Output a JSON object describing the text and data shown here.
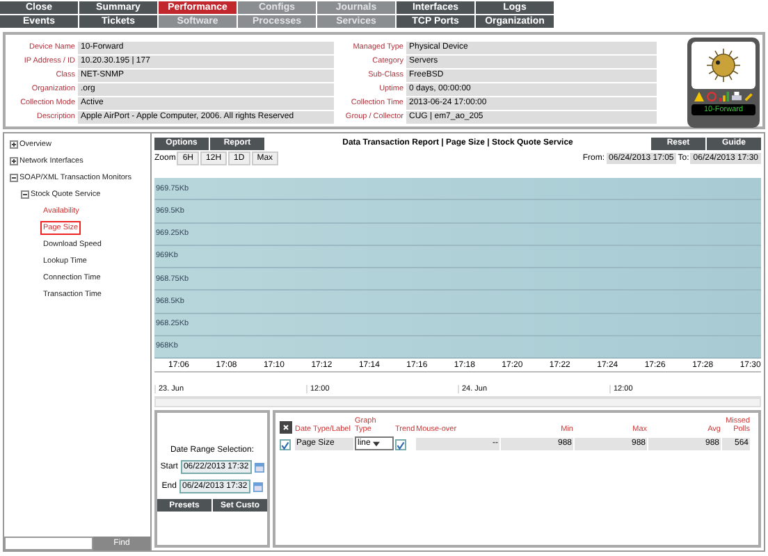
{
  "nav_rows": [
    [
      {
        "label": "Close",
        "selected": false,
        "disabled": false
      },
      {
        "label": "Summary",
        "selected": false,
        "disabled": false
      },
      {
        "label": "Performance",
        "selected": true,
        "disabled": false
      },
      {
        "label": "Configs",
        "selected": false,
        "disabled": true
      },
      {
        "label": "Journals",
        "selected": false,
        "disabled": true
      },
      {
        "label": "Interfaces",
        "selected": false,
        "disabled": false
      },
      {
        "label": "Logs",
        "selected": false,
        "disabled": false
      }
    ],
    [
      {
        "label": "Events",
        "selected": false,
        "disabled": false
      },
      {
        "label": "Tickets",
        "selected": false,
        "disabled": false
      },
      {
        "label": "Software",
        "selected": false,
        "disabled": true
      },
      {
        "label": "Processes",
        "selected": false,
        "disabled": true
      },
      {
        "label": "Services",
        "selected": false,
        "disabled": true
      },
      {
        "label": "TCP Ports",
        "selected": false,
        "disabled": false
      },
      {
        "label": "Organization",
        "selected": false,
        "disabled": false
      }
    ]
  ],
  "device_info": {
    "left": [
      {
        "label": "Device Name",
        "value": "10-Forward"
      },
      {
        "label": "IP Address / ID",
        "value": "10.20.30.195 | 177"
      },
      {
        "label": "Class",
        "value": "NET-SNMP"
      },
      {
        "label": "Organization",
        "value": ".org"
      },
      {
        "label": "Collection Mode",
        "value": "Active"
      },
      {
        "label": "Description",
        "value": "Apple AirPort - Apple Computer, 2006. All rights Reserved"
      }
    ],
    "right": [
      {
        "label": "Managed Type",
        "value": "Physical Device"
      },
      {
        "label": "Category",
        "value": "Servers"
      },
      {
        "label": "Sub-Class",
        "value": "FreeBSD"
      },
      {
        "label": "Uptime",
        "value": "0 days, 00:00:00"
      },
      {
        "label": "Collection Time",
        "value": "2013-06-24 17:00:00"
      },
      {
        "label": "Group / Collector",
        "value": "CUG | em7_ao_205"
      }
    ],
    "card_name": "10-Forward"
  },
  "tree": [
    {
      "label": "Overview",
      "expanded": false,
      "selected": false
    },
    {
      "label": "Network Interfaces",
      "expanded": false,
      "selected": false
    },
    {
      "label": "SOAP/XML Transaction Monitors",
      "expanded": true,
      "selected": false,
      "children": [
        {
          "label": "Stock Quote Service",
          "expanded": true,
          "selected": false,
          "children": [
            {
              "label": "Availability",
              "selected": false,
              "alert": true
            },
            {
              "label": "Page Size",
              "selected": true,
              "alert": true
            },
            {
              "label": "Download Speed",
              "selected": false,
              "alert": false
            },
            {
              "label": "Lookup Time",
              "selected": false,
              "alert": false
            },
            {
              "label": "Connection Time",
              "selected": false,
              "alert": false
            },
            {
              "label": "Transaction Time",
              "selected": false,
              "alert": false
            }
          ]
        }
      ]
    }
  ],
  "find_button": "Find",
  "report": {
    "left_buttons": [
      "Options",
      "Report"
    ],
    "title": "Data Transaction Report | Page Size | Stock Quote Service",
    "right_buttons": [
      "Reset",
      "Guide"
    ],
    "zoom_label": "Zoom",
    "zoom_buttons": [
      "6H",
      "12H",
      "1D",
      "Max"
    ],
    "from_label": "From:",
    "from_value": "06/24/2013 17:05",
    "to_label": "To:",
    "to_value": "06/24/2013 17:30"
  },
  "chart": {
    "y_labels": [
      "969.75Kb",
      "969.5Kb",
      "969.25Kb",
      "969Kb",
      "968.75Kb",
      "968.5Kb",
      "968.25Kb",
      "968Kb"
    ],
    "x_labels": [
      "17:06",
      "17:08",
      "17:10",
      "17:12",
      "17:14",
      "17:16",
      "17:18",
      "17:20",
      "17:22",
      "17:24",
      "17:26",
      "17:28",
      "17:30"
    ],
    "navigator_labels": [
      "23. Jun",
      "12:00",
      "24. Jun",
      "12:00"
    ]
  },
  "date_range": {
    "title": "Date Range Selection:",
    "start_label": "Start",
    "start_value": "06/22/2013 17:32",
    "end_label": "End",
    "end_value": "06/24/2013 17:32",
    "buttons": [
      "Presets",
      "Set Custo"
    ]
  },
  "legend": {
    "columns": [
      "Date Type/Label",
      "Graph Type",
      "Trend",
      "Mouse-over",
      "Min",
      "Max",
      "Avg",
      "Missed Polls"
    ],
    "rows": [
      {
        "checked": true,
        "label": "Page Size",
        "graph_type": "line",
        "trend": true,
        "mouse_over": "--",
        "min": "988",
        "max": "988",
        "avg": "988",
        "missed": "564"
      }
    ]
  }
}
